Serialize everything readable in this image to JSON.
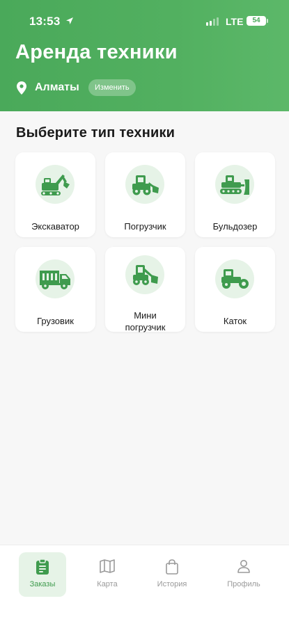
{
  "status_bar": {
    "time": "13:53",
    "network": "LTE",
    "battery": "54"
  },
  "header": {
    "title": "Аренда техники",
    "city": "Алматы",
    "change_label": "Изменить"
  },
  "section": {
    "title": "Выберите тип техники"
  },
  "equipment": [
    {
      "label": "Экскаватор",
      "icon": "excavator-icon"
    },
    {
      "label": "Погрузчик",
      "icon": "loader-icon"
    },
    {
      "label": "Бульдозер",
      "icon": "bulldozer-icon"
    },
    {
      "label": "Грузовик",
      "icon": "truck-icon"
    },
    {
      "label": "Мини погрузчик",
      "icon": "mini-loader-icon"
    },
    {
      "label": "Каток",
      "icon": "road-roller-icon"
    }
  ],
  "tabs": [
    {
      "label": "Заказы",
      "icon": "clipboard-icon",
      "active": true
    },
    {
      "label": "Карта",
      "icon": "map-icon",
      "active": false
    },
    {
      "label": "История",
      "icon": "bag-icon",
      "active": false
    },
    {
      "label": "Профиль",
      "icon": "person-icon",
      "active": false
    }
  ],
  "colors": {
    "primary": "#4aa95a",
    "accent_light": "#e6f3e7",
    "background": "#f7f7f7"
  }
}
